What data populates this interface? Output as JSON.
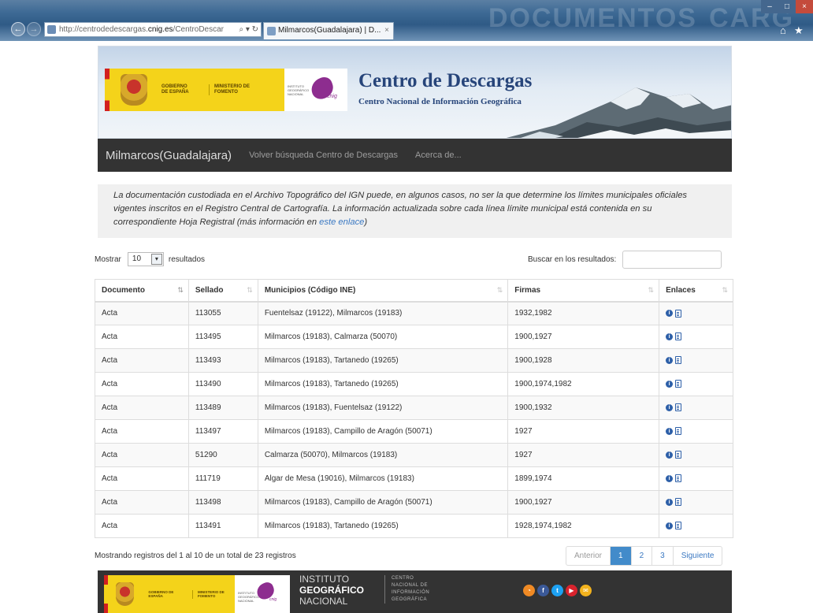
{
  "browser": {
    "url_prefix": "http://centrodedescargas.",
    "url_domain": "cnig.es",
    "url_suffix": "/CentroDescar",
    "url_tools": "⌕ ▾ ↻",
    "tab_title": "Milmarcos(Guadalajara) | D...",
    "tab_close": "×",
    "window_minimize": "–",
    "window_maximize": "□",
    "window_close": "×",
    "back_icon": "←",
    "forward_icon": "→",
    "home_icon": "⌂",
    "favorites_icon": "★",
    "background_ghost_1": "DOCUMENTOS",
    "background_ghost_2": "CARG"
  },
  "banner": {
    "gobierno": "GOBIERNO DE ESPAÑA",
    "ministerio": "MINISTERIO DE FOMENTO",
    "instituto": "INSTITUTO GEOGRÁFICO NACIONAL",
    "cnig_mark": "cnig",
    "title": "Centro de Descargas",
    "subtitle": "Centro Nacional de Información Geográfica"
  },
  "navbar": {
    "brand": "Milmarcos(Guadalajara)",
    "links": [
      "Volver búsqueda Centro de Descargas",
      "Acerca de..."
    ]
  },
  "notice": {
    "text": "La documentación custodiada en el Archivo Topográfico del IGN puede, en algunos casos, no ser la que determine los límites municipales oficiales vigentes inscritos en el Registro Central de Cartografía. La información actualizada sobre cada línea límite municipal está contenida en su correspondiente Hoja Registral (más información en ",
    "link": "este enlace",
    "tail": ")"
  },
  "controls": {
    "show_label": "Mostrar",
    "page_size": "10",
    "page_size_arrow": "▾",
    "results_label": "resultados",
    "search_label": "Buscar en los resultados:",
    "search_value": ""
  },
  "table": {
    "headers": [
      "Documento",
      "Sellado",
      "Municipios (Código INE)",
      "Firmas",
      "Enlaces"
    ],
    "sort_icon": "⇅",
    "info_glyph": "i",
    "rows": [
      [
        "Acta",
        "113055",
        "Fuentelsaz (19122), Milmarcos (19183)",
        "1932,1982"
      ],
      [
        "Acta",
        "113495",
        "Milmarcos (19183), Calmarza (50070)",
        "1900,1927"
      ],
      [
        "Acta",
        "113493",
        "Milmarcos (19183), Tartanedo (19265)",
        "1900,1928"
      ],
      [
        "Acta",
        "113490",
        "Milmarcos (19183), Tartanedo (19265)",
        "1900,1974,1982"
      ],
      [
        "Acta",
        "113489",
        "Milmarcos (19183), Fuentelsaz (19122)",
        "1900,1932"
      ],
      [
        "Acta",
        "113497",
        "Milmarcos (19183), Campillo de Aragón (50071)",
        "1927"
      ],
      [
        "Acta",
        "51290",
        "Calmarza (50070), Milmarcos (19183)",
        "1927"
      ],
      [
        "Acta",
        "111719",
        "Algar de Mesa (19016), Milmarcos (19183)",
        "1899,1974"
      ],
      [
        "Acta",
        "113498",
        "Milmarcos (19183), Campillo de Aragón (50071)",
        "1900,1927"
      ],
      [
        "Acta",
        "113491",
        "Milmarcos (19183), Tartanedo (19265)",
        "1928,1974,1982"
      ]
    ]
  },
  "summary": "Mostrando registros del 1 al 10 de un total de 23 registros",
  "pagination": {
    "prev": "Anterior",
    "pages": [
      "1",
      "2",
      "3"
    ],
    "current": "1",
    "next": "Siguiente"
  },
  "footer": {
    "instituto_top": "INSTITUTO",
    "instituto_mid": "GEOGRÁFICO",
    "instituto_bottom": "NACIONAL",
    "centro_lines": [
      "CENTRO",
      "NACIONAL DE",
      "INFORMACIÓN",
      "GEOGRÁFICA"
    ],
    "social": [
      "rss-icon",
      "facebook-icon",
      "twitter-icon",
      "youtube-icon",
      "mail-icon"
    ],
    "social_glyphs": [
      "◔",
      "f",
      "t",
      "▶",
      "✉"
    ]
  },
  "colors": {
    "navbar": "#333333",
    "link": "#3a78c2",
    "pager_active": "#428bca",
    "title": "#27457a"
  }
}
